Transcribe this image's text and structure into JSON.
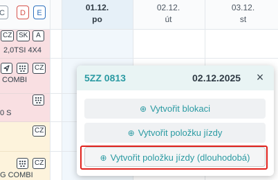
{
  "filters": [
    "C",
    "D",
    "E"
  ],
  "days": [
    {
      "date": "01.12.",
      "weekday": "po",
      "today": true
    },
    {
      "date": "02.12.",
      "weekday": "út",
      "today": false
    },
    {
      "date": "03.12.",
      "weekday": "st",
      "today": false
    }
  ],
  "rows": [
    {
      "tags": [
        "CZ",
        "SK",
        "A"
      ],
      "text": "2,0TSI 4X4"
    },
    {
      "tags": [
        "CZ"
      ],
      "text": "COMBI"
    },
    {
      "tags": [],
      "text": "0 S"
    },
    {
      "tags": [
        "CZ"
      ],
      "text": ""
    },
    {
      "tags": [
        "CZ"
      ],
      "text": "G COMBI"
    }
  ],
  "popup": {
    "plate": "5ZZ 0813",
    "date": "02.12.2025",
    "close_glyph": "×",
    "plus_glyph": "⊕",
    "buttons": {
      "create_block": "Vytvořit blokaci",
      "create_trip": "Vytvořit položku jízdy",
      "create_trip_long": "Vytvořit položku jízdy (dlouhodobá)"
    }
  },
  "colors": {
    "accent": "#2a9aa2",
    "row_pink": "#f9dfe2",
    "row_yellow": "#fdf3dc",
    "highlight": "#e0201b"
  }
}
